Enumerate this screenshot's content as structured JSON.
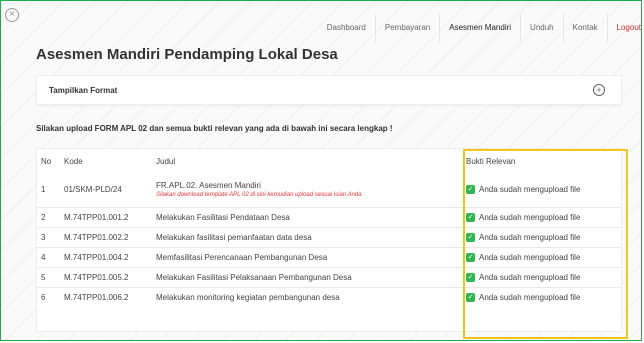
{
  "nav": {
    "items": [
      {
        "label": "Dashboard"
      },
      {
        "label": "Pembayaran"
      },
      {
        "label": "Asesmen Mandiri"
      },
      {
        "label": "Unduh"
      },
      {
        "label": "Kontak"
      },
      {
        "label": "Logout"
      }
    ]
  },
  "close_icon": "×",
  "page_title": "Asesmen Mandiri Pendamping Lokal Desa",
  "format_section": {
    "label": "Tampilkan Format",
    "toggle_icon": "+"
  },
  "instruction": "Silakan upload FORM APL 02 dan semua bukti relevan yang ada di bawah ini secara lengkap !",
  "table": {
    "headers": {
      "no": "No",
      "kode": "Kode",
      "judul": "Judul",
      "bukti": "Bukti Relevan"
    },
    "rows": [
      {
        "no": "1",
        "kode": "01/SKM-PLD/24",
        "judul": "FR.APL.02. Asesmen Mandiri",
        "note": "Silakan download template APL 02 di sini kemudian upload sesuai isian Anda",
        "bukti": "Anda sudah mengupload file"
      },
      {
        "no": "2",
        "kode": "M.74TPP01.001.2",
        "judul": "Melakukan Fasilitasi Pendataan Desa",
        "bukti": "Anda sudah mengupload file"
      },
      {
        "no": "3",
        "kode": "M.74TPP01.002.2",
        "judul": "Melakukan fasilitasi pemanfaatan data desa",
        "bukti": "Anda sudah mengupload file"
      },
      {
        "no": "4",
        "kode": "M.74TPP01.004.2",
        "judul": "Memfasilitasi Perencanaan Pembangunan Desa",
        "bukti": "Anda sudah mengupload file"
      },
      {
        "no": "5",
        "kode": "M.74TPP01.005.2",
        "judul": "Melakukan Fasilitasi Pelaksanaan Pembangunan Desa",
        "bukti": "Anda sudah mengupload file"
      },
      {
        "no": "6",
        "kode": "M.74TPP01.006.2",
        "judul": "Melakukan monitoring kegiatan pembangunan desa",
        "bukti": "Anda sudah mengupload file"
      }
    ]
  },
  "colors": {
    "accent_green": "#2fb84f",
    "highlight": "#f4c518",
    "logout": "#d32f2f",
    "note_red": "#e53935"
  }
}
